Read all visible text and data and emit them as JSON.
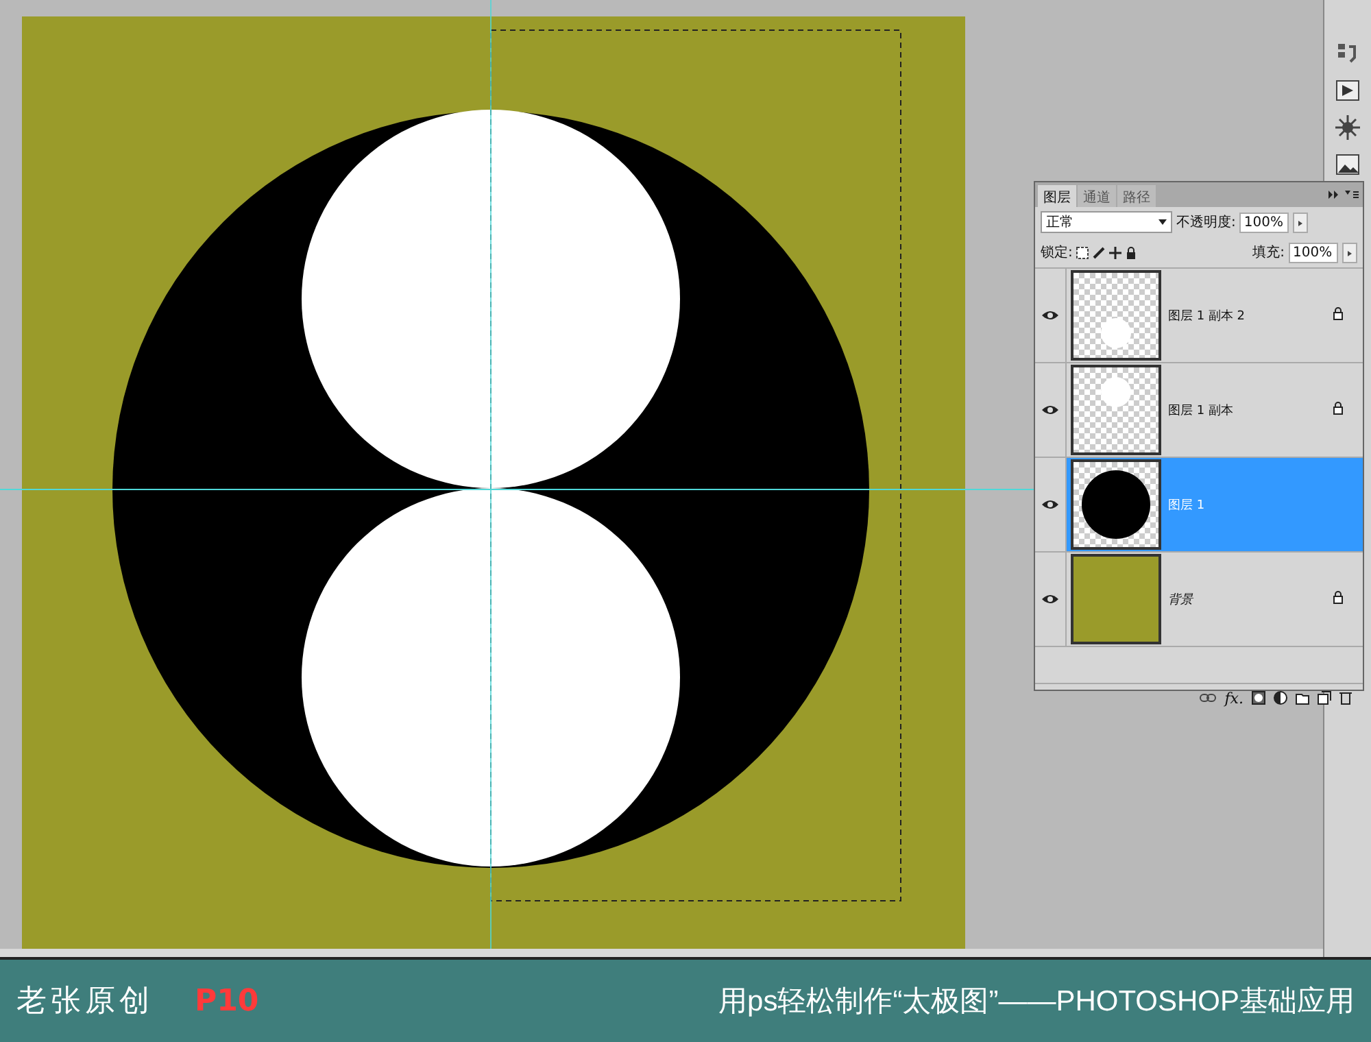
{
  "layers_panel": {
    "tabs": [
      {
        "label": "图层",
        "selected": true
      },
      {
        "label": "通道",
        "selected": false
      },
      {
        "label": "路径",
        "selected": false
      }
    ],
    "blend_mode": "正常",
    "opacity_label": "不透明度:",
    "opacity": "100%",
    "lock_label": "锁定:",
    "fill_label": "填充:",
    "fill": "100%",
    "layers": [
      {
        "name": "图层 1 副本 2",
        "kind": "layer",
        "thumbnail": {
          "kind": "circle-low"
        },
        "visible": true,
        "locked": true,
        "selected": false
      },
      {
        "name": "图层 1 副本",
        "kind": "layer",
        "thumbnail": {
          "kind": "circle-high"
        },
        "visible": true,
        "locked": true,
        "selected": false
      },
      {
        "name": "图层 1",
        "kind": "layer",
        "thumbnail": {
          "kind": "black-circle"
        },
        "visible": true,
        "locked": false,
        "selected": true
      },
      {
        "name": "背景",
        "kind": "background",
        "thumbnail": {
          "kind": "solid"
        },
        "visible": true,
        "locked": true,
        "selected": false
      }
    ],
    "effects_button": "fx."
  },
  "caption": {
    "author": "老张原创",
    "page": "P10",
    "title": "用ps轻松制作“太极图”——PHOTOSHOP基础应用"
  }
}
